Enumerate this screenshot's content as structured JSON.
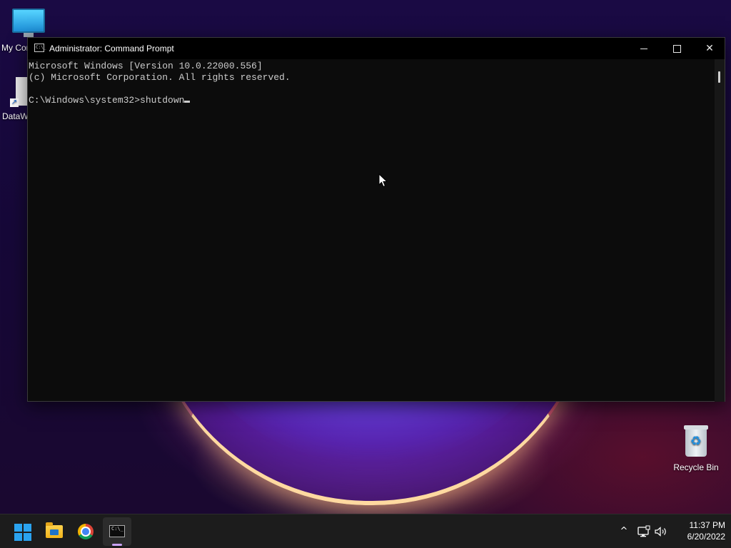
{
  "desktop": {
    "icons": [
      {
        "label": "My Computer",
        "icon": "monitor-icon"
      },
      {
        "label": "DataW",
        "icon": "document-shortcut-icon"
      },
      {
        "label": "Recycle Bin",
        "icon": "recycle-bin-icon"
      }
    ]
  },
  "window": {
    "title": "Administrator: Command Prompt",
    "app_icon_text": "C:\\_",
    "buttons": {
      "minimize": "minimize-icon",
      "maximize": "maximize-icon",
      "close": "close-icon"
    }
  },
  "console": {
    "lines": [
      "Microsoft Windows [Version 10.0.22000.556]",
      "(c) Microsoft Corporation. All rights reserved.",
      "",
      "C:\\Windows\\system32>shutdown"
    ]
  },
  "taskbar": {
    "apps": [
      {
        "name": "start",
        "icon": "windows-logo-icon"
      },
      {
        "name": "file-explorer",
        "icon": "folder-icon"
      },
      {
        "name": "chrome",
        "icon": "chrome-icon"
      },
      {
        "name": "command-prompt",
        "icon": "cmd-icon",
        "active": true
      }
    ],
    "cmd_icon_text": "C:\\_",
    "tray": {
      "chevron": "^",
      "time": "11:37 PM",
      "date": "6/20/2022"
    }
  },
  "colors": {
    "console_bg": "#0c0c0c",
    "console_fg": "#cccccc",
    "taskbar_bg": "#1c1c1c",
    "accent_blue": "#2aa3f0",
    "active_indicator": "#c9a2f5"
  }
}
